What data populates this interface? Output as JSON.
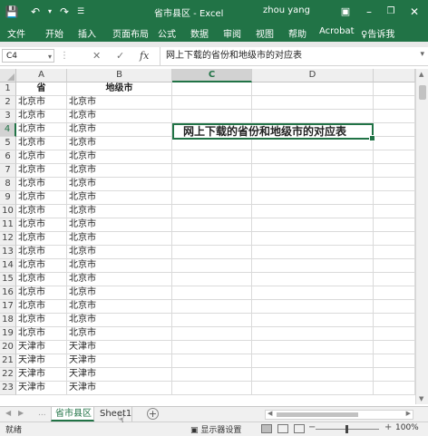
{
  "window": {
    "title": "省市县区 - Excel",
    "user": "zhou yang",
    "icons": [
      "save-icon",
      "undo-icon",
      "redo-icon",
      "customize-icon",
      "ribbon-options-icon",
      "minimize-icon",
      "restore-icon",
      "close-icon"
    ]
  },
  "ribbon": {
    "tabs": [
      "文件",
      "开始",
      "插入",
      "页面布局",
      "公式",
      "数据",
      "审阅",
      "视图",
      "帮助",
      "Acrobat"
    ],
    "tell_me": "♀告诉我"
  },
  "formula_bar": {
    "name_box": "C4",
    "fx": "fx",
    "content": "网上下载的省份和地级市的对应表"
  },
  "grid": {
    "columns": [
      "A",
      "B",
      "C",
      "D"
    ],
    "selected_column": "C",
    "selected_row": "4",
    "rows": [
      {
        "num": "1",
        "a": "省",
        "b": "地级市"
      },
      {
        "num": "2",
        "a": "北京市",
        "b": "北京市"
      },
      {
        "num": "3",
        "a": "北京市",
        "b": "北京市"
      },
      {
        "num": "4",
        "a": "北京市",
        "b": "北京市"
      },
      {
        "num": "5",
        "a": "北京市",
        "b": "北京市"
      },
      {
        "num": "6",
        "a": "北京市",
        "b": "北京市"
      },
      {
        "num": "7",
        "a": "北京市",
        "b": "北京市"
      },
      {
        "num": "8",
        "a": "北京市",
        "b": "北京市"
      },
      {
        "num": "9",
        "a": "北京市",
        "b": "北京市"
      },
      {
        "num": "10",
        "a": "北京市",
        "b": "北京市"
      },
      {
        "num": "11",
        "a": "北京市",
        "b": "北京市"
      },
      {
        "num": "12",
        "a": "北京市",
        "b": "北京市"
      },
      {
        "num": "13",
        "a": "北京市",
        "b": "北京市"
      },
      {
        "num": "14",
        "a": "北京市",
        "b": "北京市"
      },
      {
        "num": "15",
        "a": "北京市",
        "b": "北京市"
      },
      {
        "num": "16",
        "a": "北京市",
        "b": "北京市"
      },
      {
        "num": "17",
        "a": "北京市",
        "b": "北京市"
      },
      {
        "num": "18",
        "a": "北京市",
        "b": "北京市"
      },
      {
        "num": "19",
        "a": "北京市",
        "b": "北京市"
      },
      {
        "num": "20",
        "a": "天津市",
        "b": "天津市"
      },
      {
        "num": "21",
        "a": "天津市",
        "b": "天津市"
      },
      {
        "num": "22",
        "a": "天津市",
        "b": "天津市"
      },
      {
        "num": "23",
        "a": "天津市",
        "b": "天津市"
      }
    ],
    "active_cell_text": "网上下载的省份和地级市的对应表"
  },
  "sheets": {
    "tabs": [
      "省市县区",
      "Sheet1"
    ],
    "active": "省市县区",
    "add_label": "+",
    "more": "..."
  },
  "status_bar": {
    "ready": "就绪",
    "display_settings": "显示器设置",
    "zoom": "100%",
    "zoom_out": "−",
    "zoom_in": "+"
  }
}
